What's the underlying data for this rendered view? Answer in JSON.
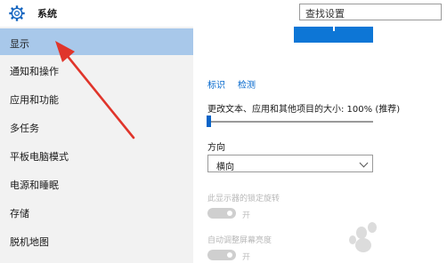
{
  "window": {
    "title": "系统",
    "search_placeholder": "查找设置"
  },
  "sidebar": {
    "items": [
      {
        "label": "显示"
      },
      {
        "label": "通知和操作"
      },
      {
        "label": "应用和功能"
      },
      {
        "label": "多任务"
      },
      {
        "label": "平板电脑模式"
      },
      {
        "label": "电源和睡眠"
      },
      {
        "label": "存储"
      },
      {
        "label": "脱机地图"
      }
    ],
    "active_index": 0
  },
  "display": {
    "identify_link": "标识",
    "detect_link": "检测",
    "scale_label": "更改文本、应用和其他项目的大小: 100% (推荐)",
    "scale_value_percent": 100,
    "orientation_label": "方向",
    "orientation_value": "横向",
    "lock_rotation_label": "此显示器的锁定旋转",
    "lock_rotation_state": "开",
    "auto_brightness_label": "自动调整屏幕亮度",
    "auto_brightness_state": "开"
  },
  "colors": {
    "accent": "#0d76d6",
    "active_nav": "#a8c8ea",
    "annotation_arrow": "#e0352b"
  },
  "icons": {
    "settings": "gear-icon",
    "dropdown": "chevron-down-icon"
  }
}
